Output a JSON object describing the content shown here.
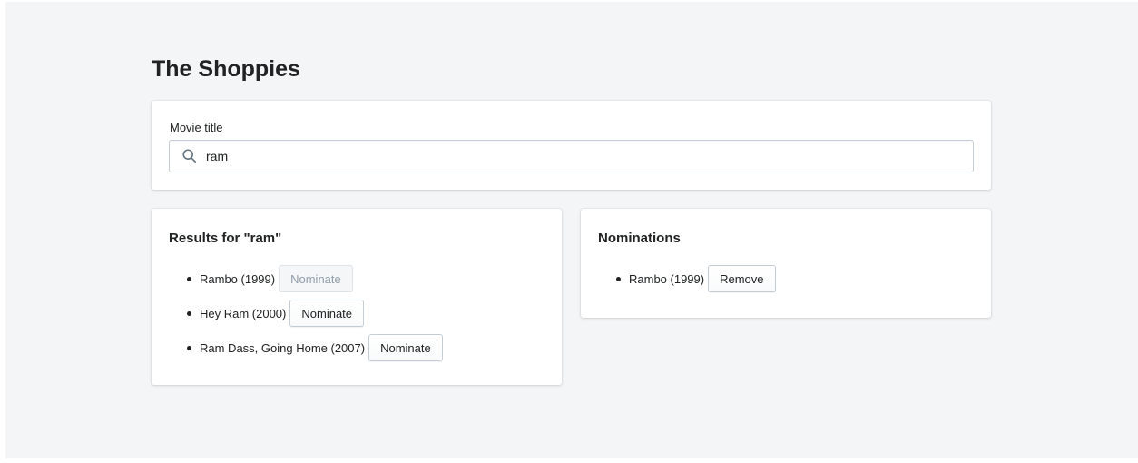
{
  "app": {
    "title": "The Shoppies"
  },
  "search": {
    "label": "Movie title",
    "value": "ram",
    "icon": "search-icon"
  },
  "results": {
    "heading": "Results for \"ram\"",
    "items": [
      {
        "title": "Rambo (1999)",
        "button_label": "Nominate",
        "disabled": true
      },
      {
        "title": "Hey Ram (2000)",
        "button_label": "Nominate",
        "disabled": false
      },
      {
        "title": "Ram Dass, Going Home (2007)",
        "button_label": "Nominate",
        "disabled": false
      }
    ]
  },
  "nominations": {
    "heading": "Nominations",
    "items": [
      {
        "title": "Rambo (1999)",
        "button_label": "Remove"
      }
    ]
  },
  "colors": {
    "background": "#f4f5f7",
    "card": "#ffffff",
    "text": "#202223",
    "disabled_text": "#919eab",
    "border": "#c4cdd5"
  }
}
